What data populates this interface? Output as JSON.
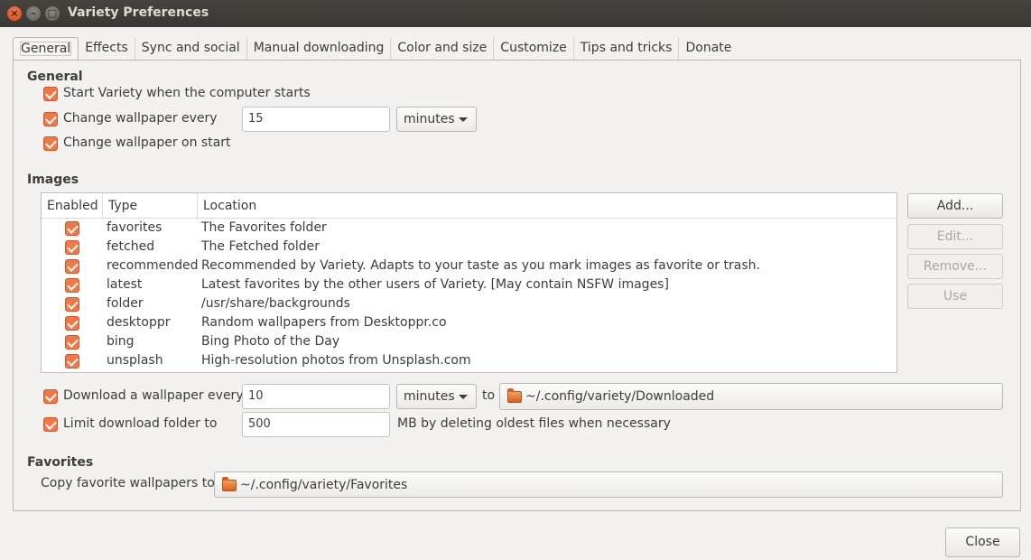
{
  "window": {
    "title": "Variety Preferences"
  },
  "tabs": [
    {
      "label": "General"
    },
    {
      "label": "Effects"
    },
    {
      "label": "Sync and social"
    },
    {
      "label": "Manual downloading"
    },
    {
      "label": "Color and size"
    },
    {
      "label": "Customize"
    },
    {
      "label": "Tips and tricks"
    },
    {
      "label": "Donate"
    }
  ],
  "general": {
    "title": "General",
    "start_on_login": "Start Variety when the computer starts",
    "change_every": "Change wallpaper every",
    "interval_value": "15",
    "interval_unit": "minutes",
    "change_on_start": "Change wallpaper on start"
  },
  "images": {
    "title": "Images",
    "columns": {
      "enabled": "Enabled",
      "type": "Type",
      "location": "Location"
    },
    "rows": [
      {
        "type": "favorites",
        "location": "The Favorites folder"
      },
      {
        "type": "fetched",
        "location": "The Fetched folder"
      },
      {
        "type": "recommended",
        "location": "Recommended by Variety. Adapts to your taste as you mark images as favorite or trash."
      },
      {
        "type": "latest",
        "location": "Latest favorites by the other users of Variety. [May contain NSFW images]"
      },
      {
        "type": "folder",
        "location": "/usr/share/backgrounds"
      },
      {
        "type": "desktoppr",
        "location": "Random wallpapers from Desktoppr.co"
      },
      {
        "type": "bing",
        "location": "Bing Photo of the Day"
      },
      {
        "type": "unsplash",
        "location": "High-resolution photos from Unsplash.com"
      }
    ],
    "buttons": {
      "add": "Add...",
      "edit": "Edit...",
      "remove": "Remove...",
      "use": "Use"
    }
  },
  "download": {
    "label": "Download a wallpaper every",
    "value": "10",
    "unit": "minutes",
    "to": "to",
    "folder": "~/.config/variety/Downloaded",
    "limit_label": "Limit download folder to",
    "limit_value": "500",
    "limit_suffix": "MB by deleting oldest files when necessary"
  },
  "favorites": {
    "title": "Favorites",
    "copy_label": "Copy favorite wallpapers to",
    "folder": "~/.config/variety/Favorites"
  },
  "footer": {
    "close": "Close"
  },
  "colors": {
    "accent": "#f07746",
    "titlebar": "#3c3b37"
  }
}
